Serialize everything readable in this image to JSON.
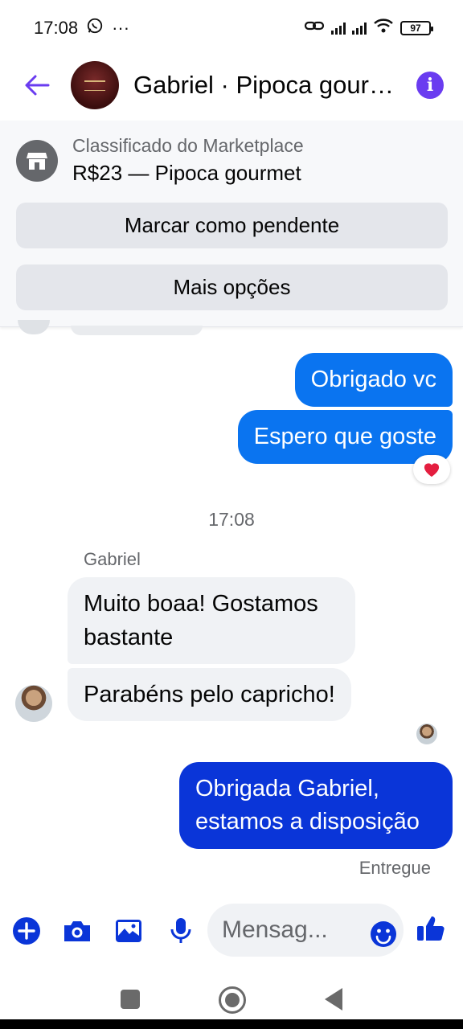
{
  "status_bar": {
    "time": "17:08",
    "extra": "···",
    "battery": "97"
  },
  "header": {
    "title": "Gabriel · Pipoca gourmet",
    "icons": {
      "back": "back-arrow-icon",
      "info": "info-icon"
    }
  },
  "marketplace": {
    "caption": "Classificado do Marketplace",
    "title": "R$23 — Pipoca gourmet",
    "mark_pending_label": "Marcar como pendente",
    "more_options_label": "Mais opções",
    "icon": "storefront-icon"
  },
  "messages": {
    "out1": "Obrigado vc",
    "out2": "Espero que goste",
    "reaction": "heart",
    "timestamp": "17:08",
    "sender": "Gabriel",
    "in1": "Muito boaa! Gostamos bastante",
    "in2": "Parabéns pelo capricho!",
    "out3": "Obrigada Gabriel, estamos a disposição",
    "delivered": "Entregue"
  },
  "composer": {
    "placeholder": "Mensag...",
    "icons": [
      "plus-icon",
      "camera-icon",
      "gallery-icon",
      "microphone-icon",
      "emoji-icon",
      "thumbs-up-icon"
    ]
  },
  "colors": {
    "accent": "#6a3cf0",
    "outgoing_bubble": "#0a74f0",
    "outgoing_bubble_dark": "#0a35d8",
    "incoming_bubble": "#f0f2f5",
    "reaction": "#e41e3f"
  }
}
